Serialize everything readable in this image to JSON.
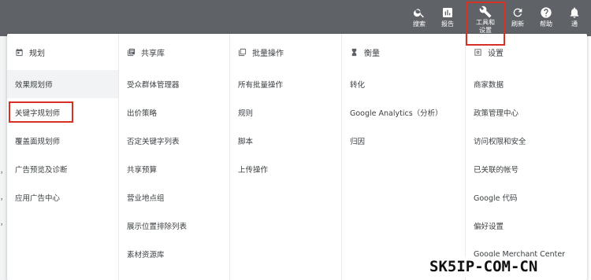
{
  "topbar": {
    "buttons": [
      {
        "label": "搜索",
        "icon": "search-icon"
      },
      {
        "label": "报告",
        "icon": "reports-icon"
      },
      {
        "label": "工具和设置",
        "icon": "wrench-icon"
      },
      {
        "label": "刷新",
        "icon": "refresh-icon"
      },
      {
        "label": "帮助",
        "icon": "help-icon"
      },
      {
        "label": "通",
        "icon": "bell-icon"
      }
    ]
  },
  "background": {
    "ghost_1": "，",
    "ghost_2": "，",
    "ghost_3": "，"
  },
  "columns": [
    {
      "title": "规划",
      "icon": "calendar-icon",
      "items": [
        "效果规划师",
        "关键字规划师",
        "覆盖面规划师",
        "广告预览及诊断",
        "应用广告中心"
      ]
    },
    {
      "title": "共享库",
      "icon": "library-icon",
      "items": [
        "受众群体管理器",
        "出价策略",
        "否定关键字列表",
        "共享预算",
        "营业地点组",
        "展示位置排除列表",
        "素材资源库"
      ]
    },
    {
      "title": "批量操作",
      "icon": "bulk-actions-icon",
      "items": [
        "所有批量操作",
        "规则",
        "脚本",
        "上传操作"
      ]
    },
    {
      "title": "衡量",
      "icon": "hourglass-icon",
      "items": [
        "转化",
        "Google Analytics（分析）",
        "归因"
      ]
    },
    {
      "title": "设置",
      "icon": "settings-icon",
      "items": [
        "商家数据",
        "政策管理中心",
        "访问权限和安全",
        "已关联的帐号",
        "Google 代码",
        "偏好设置",
        "Google Merchant Center"
      ]
    }
  ],
  "watermark": "SK5IP-COM-CN",
  "colors": {
    "topbar": "#5f6368",
    "highlight": "#d93025",
    "active_bg": "#f1f3f4"
  }
}
